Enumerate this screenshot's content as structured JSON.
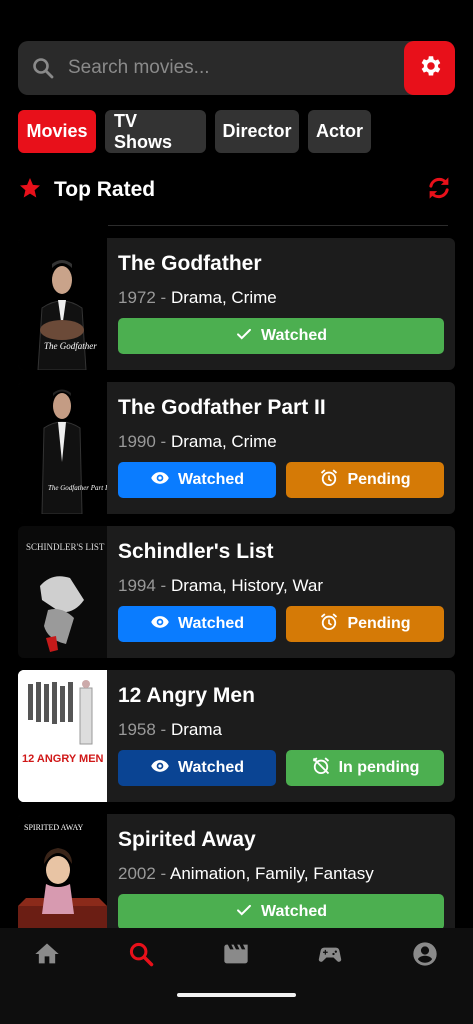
{
  "search": {
    "placeholder": "Search movies..."
  },
  "tabs": [
    {
      "label": "Movies",
      "active": true
    },
    {
      "label": "TV Shows",
      "active": false
    },
    {
      "label": "Director",
      "active": false
    },
    {
      "label": "Actor",
      "active": false
    }
  ],
  "section": {
    "title": "Top Rated"
  },
  "movies": [
    {
      "title": "The Godfather",
      "year": "1972",
      "separator": " - ",
      "genres": "Drama, Crime",
      "poster_text": "The Godfather",
      "buttons": [
        {
          "label": "Watched",
          "icon": "check-icon",
          "color": "#4caf50"
        }
      ]
    },
    {
      "title": "The Godfather Part II",
      "year": "1990",
      "separator": " - ",
      "genres": "Drama, Crime",
      "poster_text": "The Godfather Part II",
      "buttons": [
        {
          "label": "Watched",
          "icon": "eye-icon",
          "color": "#0a7cff"
        },
        {
          "label": "Pending",
          "icon": "alarm-icon",
          "color": "#d57a06"
        }
      ]
    },
    {
      "title": "Schindler's List",
      "year": "1994",
      "separator": " - ",
      "genres": "Drama, History, War",
      "poster_text": "SCHINDLER'S LIST",
      "buttons": [
        {
          "label": "Watched",
          "icon": "eye-icon",
          "color": "#0a7cff"
        },
        {
          "label": "Pending",
          "icon": "alarm-icon",
          "color": "#d57a06"
        }
      ]
    },
    {
      "title": "12 Angry Men",
      "year": "1958",
      "separator": " - ",
      "genres": "Drama",
      "poster_text": "12 ANGRY MEN",
      "buttons": [
        {
          "label": "Watched",
          "icon": "eye-icon",
          "color": "#0a4493"
        },
        {
          "label": "In pending",
          "icon": "alarm-off-icon",
          "color": "#4caf50"
        }
      ]
    },
    {
      "title": "Spirited Away",
      "year": "2002",
      "separator": " - ",
      "genres": "Animation, Family, Fantasy",
      "poster_text": "SPIRITED AWAY",
      "buttons": [
        {
          "label": "Watched",
          "icon": "check-icon",
          "color": "#4caf50"
        }
      ]
    }
  ],
  "nav": [
    {
      "icon": "home-icon",
      "active": false
    },
    {
      "icon": "search-icon",
      "active": true
    },
    {
      "icon": "movie-clapper-icon",
      "active": false
    },
    {
      "icon": "gamepad-icon",
      "active": false
    },
    {
      "icon": "account-icon",
      "active": false
    }
  ],
  "colors": {
    "accent": "#e8101a",
    "background": "#000000",
    "card": "#1c1c1c",
    "watched_green": "#4caf50",
    "watched_blue": "#0a7cff",
    "pending_orange": "#d57a06"
  }
}
